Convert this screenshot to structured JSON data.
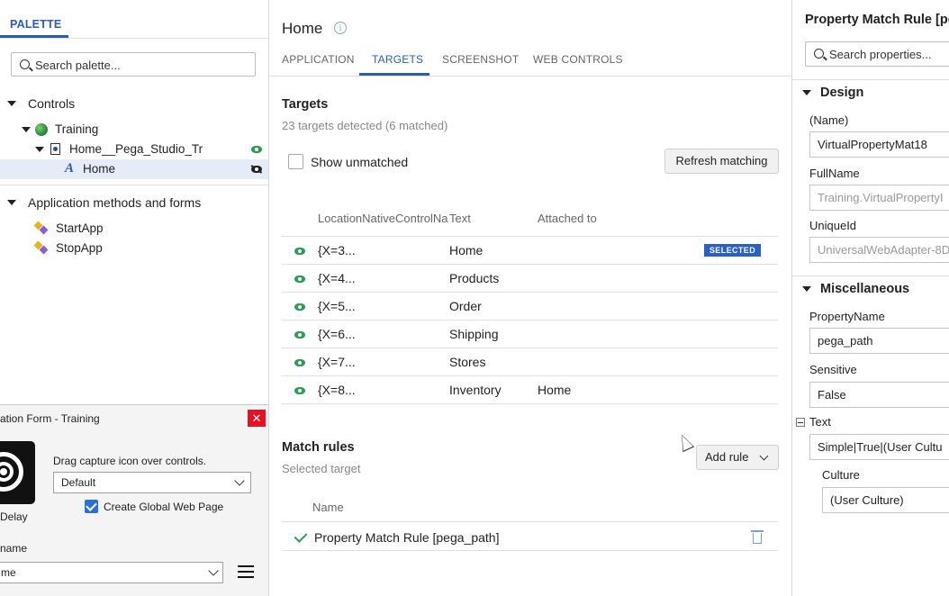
{
  "left": {
    "tab_label": "PALETTE",
    "search_placeholder": "Search palette...",
    "sections": {
      "controls": "Controls",
      "app_methods": "Application methods and forms"
    },
    "tree": {
      "training": "Training",
      "page": "Home__Pega_Studio_Tr",
      "home": "Home"
    },
    "methods": [
      "StartApp",
      "StopApp"
    ]
  },
  "capture": {
    "title": "ation Form - Training",
    "close_label": "✕",
    "instruction": "Drag capture icon over controls.",
    "select_value": "Default",
    "checkbox_label": "Create Global Web Page",
    "delay_label": "Delay",
    "name_label": "name",
    "name_value": "me"
  },
  "main": {
    "title": "Home",
    "info_glyph": "i",
    "tabs": [
      "APPLICATION",
      "TARGETS",
      "SCREENSHOT",
      "WEB CONTROLS"
    ],
    "active_tab": "TARGETS",
    "targets_heading": "Targets",
    "targets_summary": "23 targets detected (6 matched)",
    "show_unmatched": "Show unmatched",
    "refresh_button": "Refresh matching",
    "columns": [
      "LocationNativeControlNa",
      "Text",
      "Attached to"
    ],
    "rows": [
      {
        "location": "{X=3...",
        "text": "Home",
        "attached": "",
        "badge": "SELECTED"
      },
      {
        "location": "{X=4...",
        "text": "Products",
        "attached": ""
      },
      {
        "location": "{X=5...",
        "text": "Order",
        "attached": ""
      },
      {
        "location": "{X=6...",
        "text": "Shipping",
        "attached": ""
      },
      {
        "location": "{X=7...",
        "text": "Stores",
        "attached": ""
      },
      {
        "location": "{X=8...",
        "text": "Inventory",
        "attached": "Home"
      }
    ],
    "match_rules_heading": "Match rules",
    "match_rules_sub": "Selected target",
    "add_rule_button": "Add rule",
    "rules_column": "Name",
    "rules": [
      "Property Match Rule [pega_path]"
    ]
  },
  "right": {
    "title": "Property Match Rule [pe",
    "search_placeholder": "Search properties...",
    "design_section": "Design",
    "fields": {
      "name_label": "(Name)",
      "name_value": "VirtualPropertyMat18",
      "fullname_label": "FullName",
      "fullname_value": "Training.VirtualPropertyI",
      "uniqueid_label": "UniqueId",
      "uniqueid_value": "UniversalWebAdapter-8D"
    },
    "misc_section": "Miscellaneous",
    "misc": {
      "propname_label": "PropertyName",
      "propname_value": "pega_path",
      "sensitive_label": "Sensitive",
      "sensitive_value": "False",
      "text_label": "Text",
      "text_value": "Simple|True|(User Cultu",
      "culture_label": "Culture",
      "culture_value": "(User Culture)"
    }
  },
  "colors": {
    "accent": "#2a5db0",
    "eye_green": "#2e9b55",
    "badge_blue": "#2a5fc8",
    "close_red": "#e81123"
  }
}
